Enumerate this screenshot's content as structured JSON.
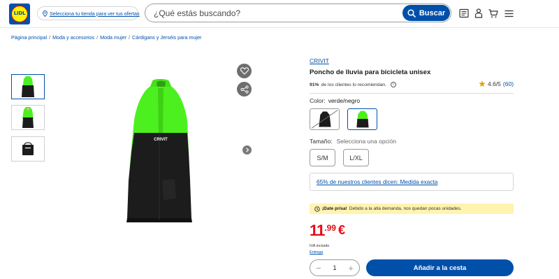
{
  "header": {
    "logo_text": "LIDL",
    "store_link": "Selecciona tu tienda para ver tus ofertas",
    "search_placeholder": "¿Qué estás buscando?",
    "search_button": "Buscar"
  },
  "breadcrumb": [
    "Página principal",
    "Moda y accesorios",
    "Moda mujer",
    "Cárdigans y Jerséis para mujer"
  ],
  "product": {
    "brand": "CRIVIT",
    "title": "Poncho de lluvia para bicicleta unisex",
    "recommend_pct": "91%",
    "recommend_text": "de los clientes lo recomiendan.",
    "rating": "4.6/5",
    "rating_count": "(60)",
    "color_label": "Color:",
    "color_value": "verde/negro",
    "size_label": "Tamaño:",
    "size_hint": "Selecciona una opción",
    "sizes": [
      "S/M",
      "L/XL"
    ],
    "fit_text": "65% de nuestros clientes dicen: Medida exacta",
    "hurry_bold": "¡Date prisa!",
    "hurry_text": "Debido a la alta demanda, nos quedan pocas unidades.",
    "price_int": "11",
    "price_dec": ".99",
    "currency": "€",
    "vat": "IVA incluido",
    "delivery": "Entrega",
    "quantity": "1",
    "add_to_cart": "Añadir a la cesta",
    "print_brand": "CRIVIT"
  },
  "colors": {
    "accent": "#0050aa",
    "price": "#e60a14",
    "poncho_green": "#4cf01e",
    "poncho_black": "#1c1c1c",
    "hurry_bg": "#fff3b0"
  }
}
